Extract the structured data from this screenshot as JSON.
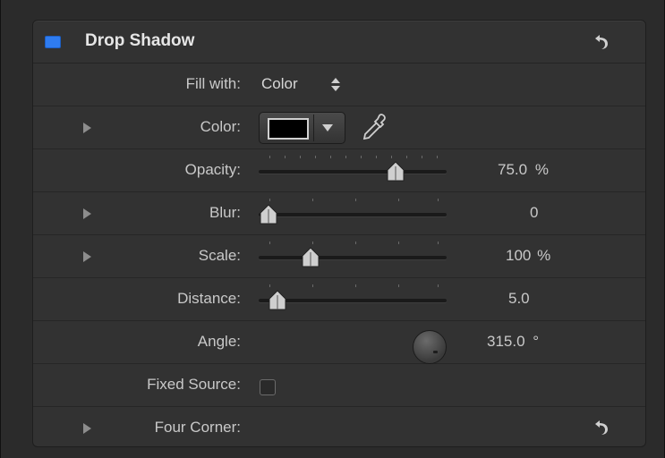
{
  "header": {
    "title": "Drop Shadow",
    "enabled_color": "#2f7cf0",
    "enable_icon": "enable-checkbox-icon",
    "reset_icon": "reset-arrow-icon"
  },
  "rows": {
    "fill_with": {
      "label": "Fill with:",
      "value": "Color"
    },
    "color": {
      "label": "Color:",
      "swatch_color": "#000000",
      "dropper_icon": "eyedropper-icon"
    },
    "opacity": {
      "label": "Opacity:",
      "value": "75.0",
      "unit": "%",
      "slider_fraction": 0.75
    },
    "blur": {
      "label": "Blur:",
      "value": "0",
      "slider_fraction": 0.0
    },
    "scale": {
      "label": "Scale:",
      "value": "100",
      "unit": "%",
      "slider_fraction": 0.25
    },
    "distance": {
      "label": "Distance:",
      "value": "5.0",
      "slider_fraction": 0.05
    },
    "angle": {
      "label": "Angle:",
      "value": "315.0",
      "unit": "°"
    },
    "fixed_source": {
      "label": "Fixed Source:",
      "checked": false
    },
    "four_corner": {
      "label": "Four Corner:"
    }
  }
}
